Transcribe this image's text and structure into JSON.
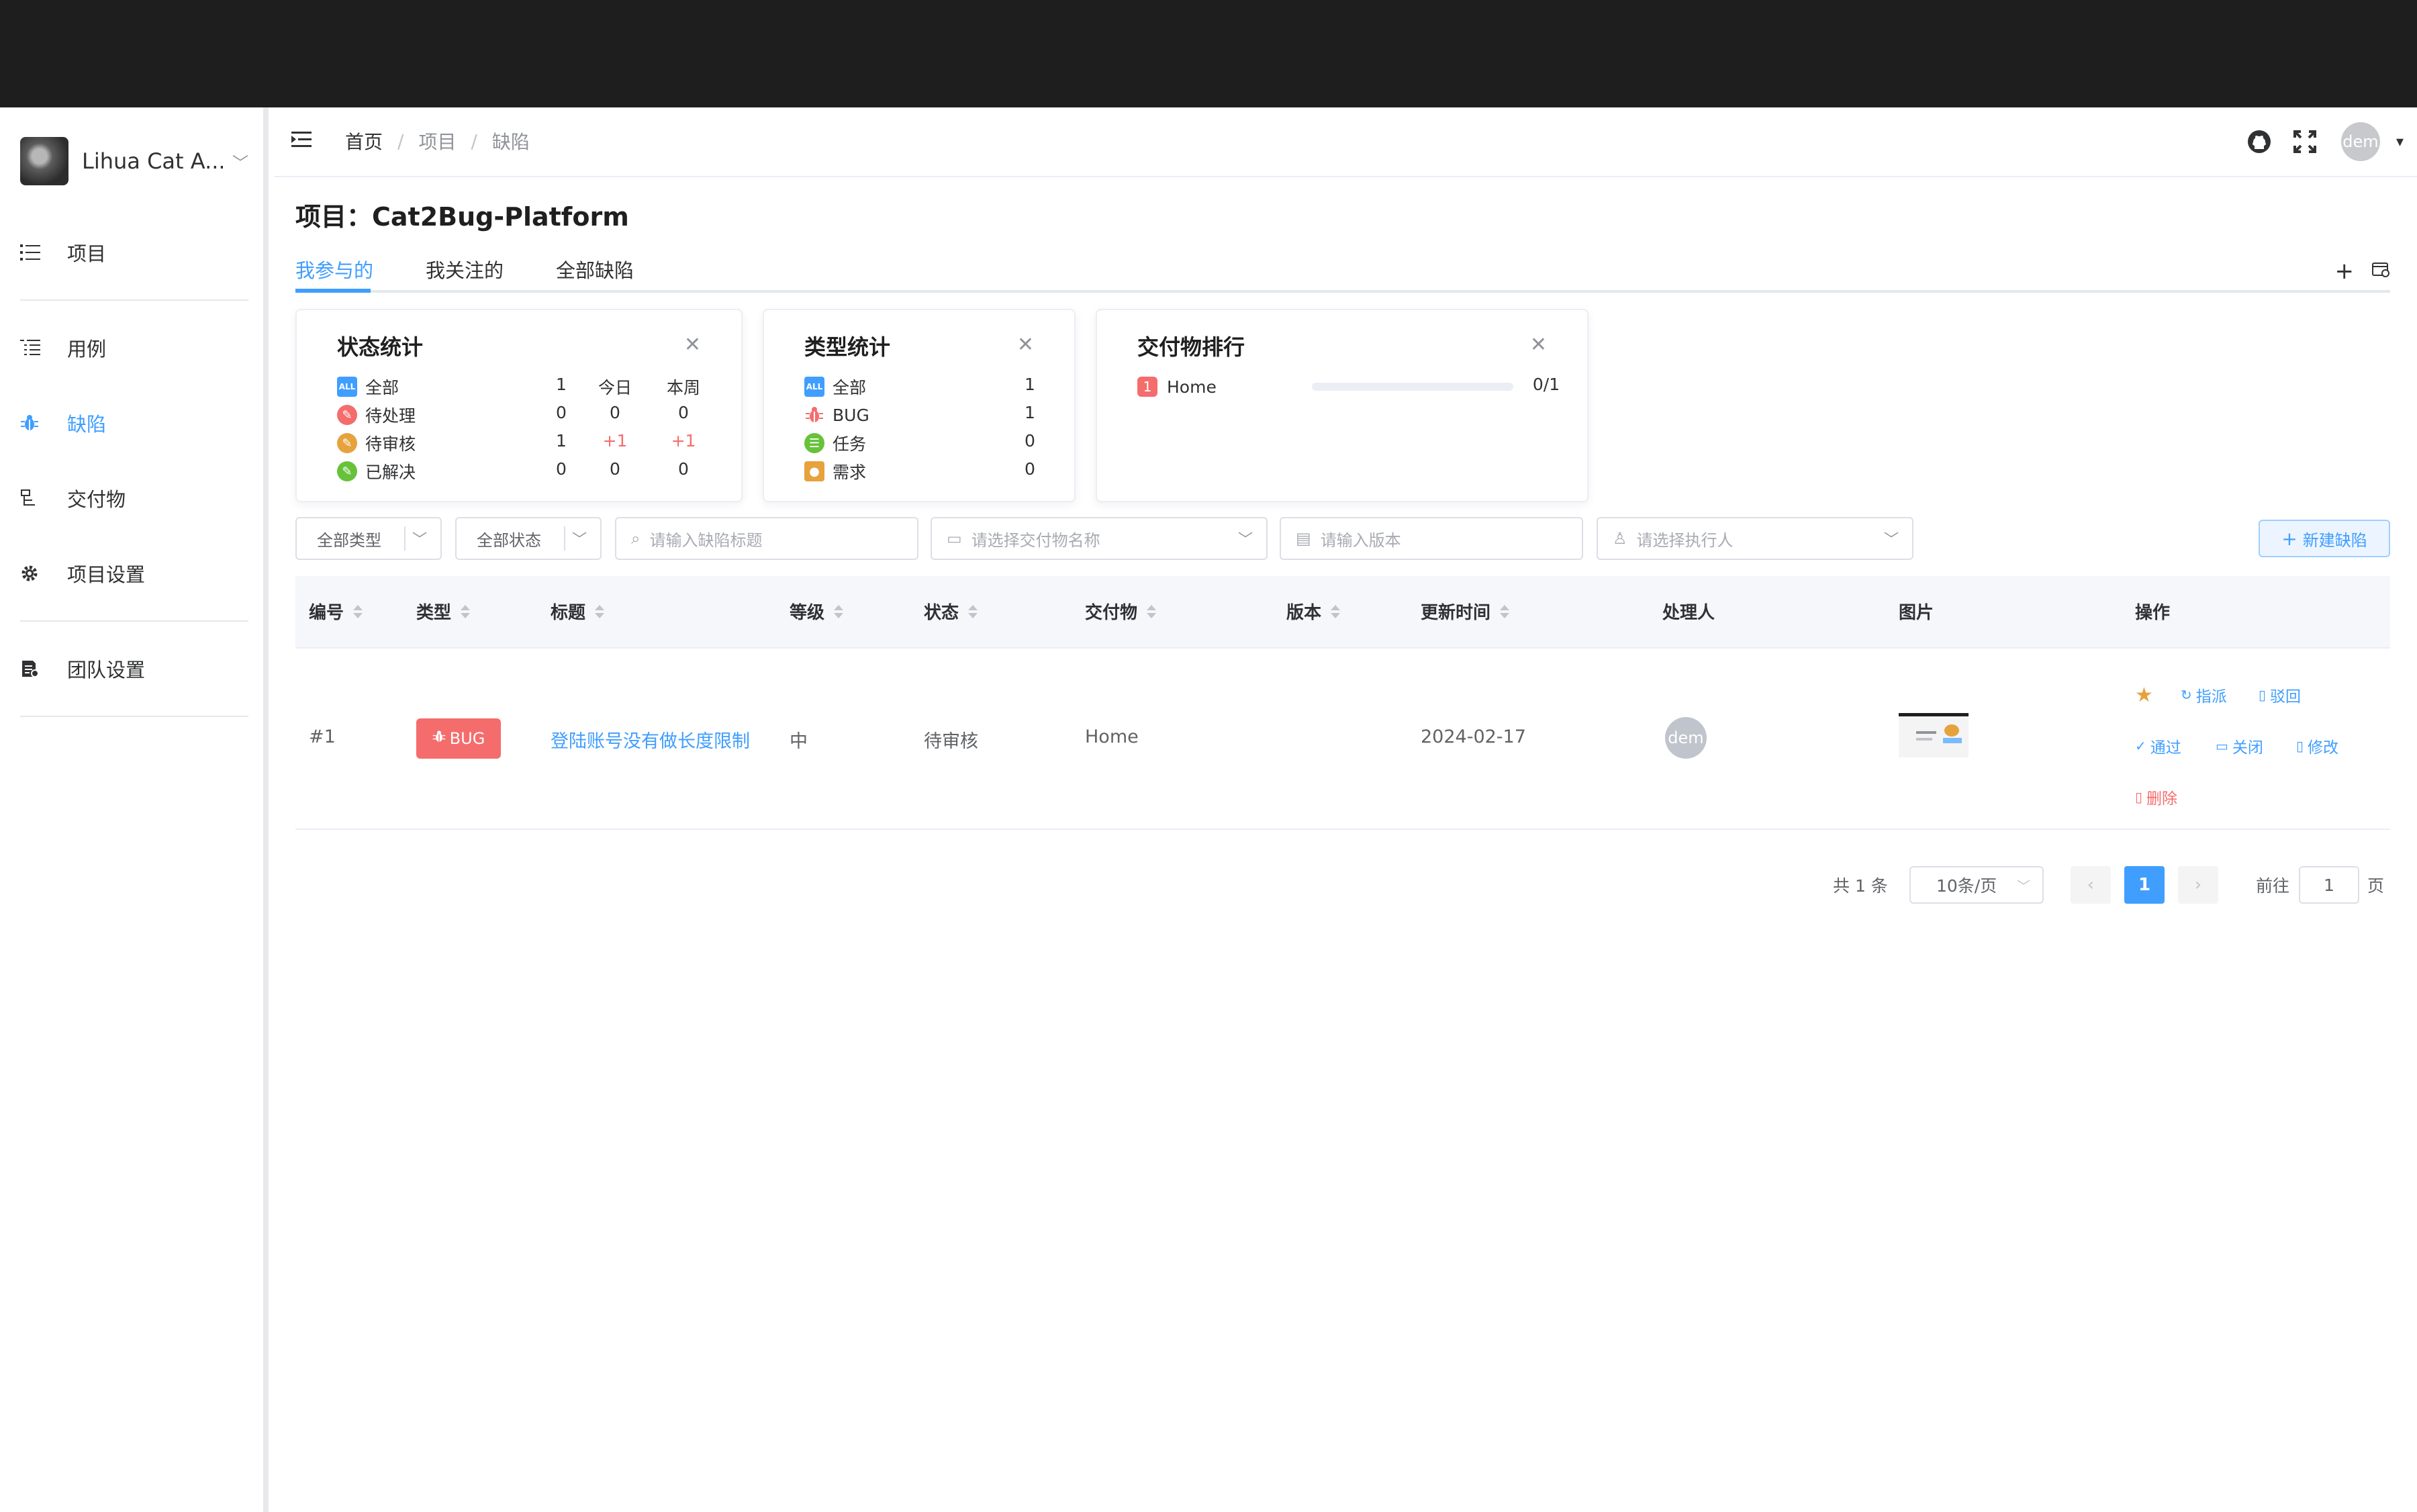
{
  "sidebar": {
    "brand_name": "Lihua Cat A...",
    "items": [
      {
        "label": "项目",
        "icon": "list-icon"
      },
      {
        "label": "用例",
        "icon": "tree-list-icon"
      },
      {
        "label": "缺陷",
        "icon": "bug-icon"
      },
      {
        "label": "交付物",
        "icon": "deliverable-icon"
      },
      {
        "label": "项目设置",
        "icon": "gear-icon"
      },
      {
        "label": "团队设置",
        "icon": "team-doc-icon"
      }
    ]
  },
  "header": {
    "breadcrumb": [
      "首页",
      "项目",
      "缺陷"
    ],
    "avatar_text": "dem"
  },
  "page": {
    "title": "项目：Cat2Bug-Platform"
  },
  "tabs": [
    "我参与的",
    "我关注的",
    "全部缺陷"
  ],
  "status_card": {
    "title": "状态统计",
    "columns": [
      "今日",
      "本周"
    ],
    "rows": [
      {
        "label": "全部",
        "icon": "all-icon",
        "total": "1",
        "today": "",
        "week": ""
      },
      {
        "label": "待处理",
        "icon": "pending-icon",
        "total": "0",
        "today": "0",
        "week": "0"
      },
      {
        "label": "待审核",
        "icon": "review-icon",
        "total": "1",
        "today": "+1",
        "week": "+1"
      },
      {
        "label": "已解决",
        "icon": "resolved-icon",
        "total": "0",
        "today": "0",
        "week": "0"
      }
    ]
  },
  "type_card": {
    "title": "类型统计",
    "rows": [
      {
        "label": "全部",
        "icon": "all-icon",
        "count": "1"
      },
      {
        "label": "BUG",
        "icon": "bug-icon",
        "count": "1"
      },
      {
        "label": "任务",
        "icon": "task-icon",
        "count": "0"
      },
      {
        "label": "需求",
        "icon": "requirement-icon",
        "count": "0"
      }
    ]
  },
  "delivery_card": {
    "title": "交付物排行",
    "items": [
      {
        "rank": "1",
        "name": "Home",
        "ratio": "0/1",
        "progress": 0
      }
    ]
  },
  "filters": {
    "type": "全部类型",
    "state": "全部状态",
    "title_placeholder": "请输入缺陷标题",
    "deliverable_placeholder": "请选择交付物名称",
    "version_placeholder": "请输入版本",
    "assignee_placeholder": "请选择执行人",
    "new_button": "新建缺陷"
  },
  "table": {
    "columns": [
      "编号",
      "类型",
      "标题",
      "等级",
      "状态",
      "交付物",
      "版本",
      "更新时间",
      "处理人",
      "图片",
      "操作"
    ],
    "rows": [
      {
        "id": "#1",
        "type": "BUG",
        "title": "登陆账号没有做长度限制",
        "level": "中",
        "state": "待审核",
        "deliverable": "Home",
        "version": "",
        "updated": "2024-02-17",
        "assignee": "dem"
      }
    ],
    "actions": {
      "assign": "指派",
      "reject": "驳回",
      "pass": "通过",
      "close": "关闭",
      "edit": "修改",
      "delete": "删除"
    }
  },
  "pagination": {
    "total": "共 1 条",
    "page_size": "10条/页",
    "current": "1",
    "goto_prefix": "前往",
    "goto_value": "1",
    "goto_suffix": "页"
  },
  "colors": {
    "primary": "#409eff",
    "danger": "#f56c6c",
    "warning": "#e6a23c",
    "success": "#67c23a"
  }
}
